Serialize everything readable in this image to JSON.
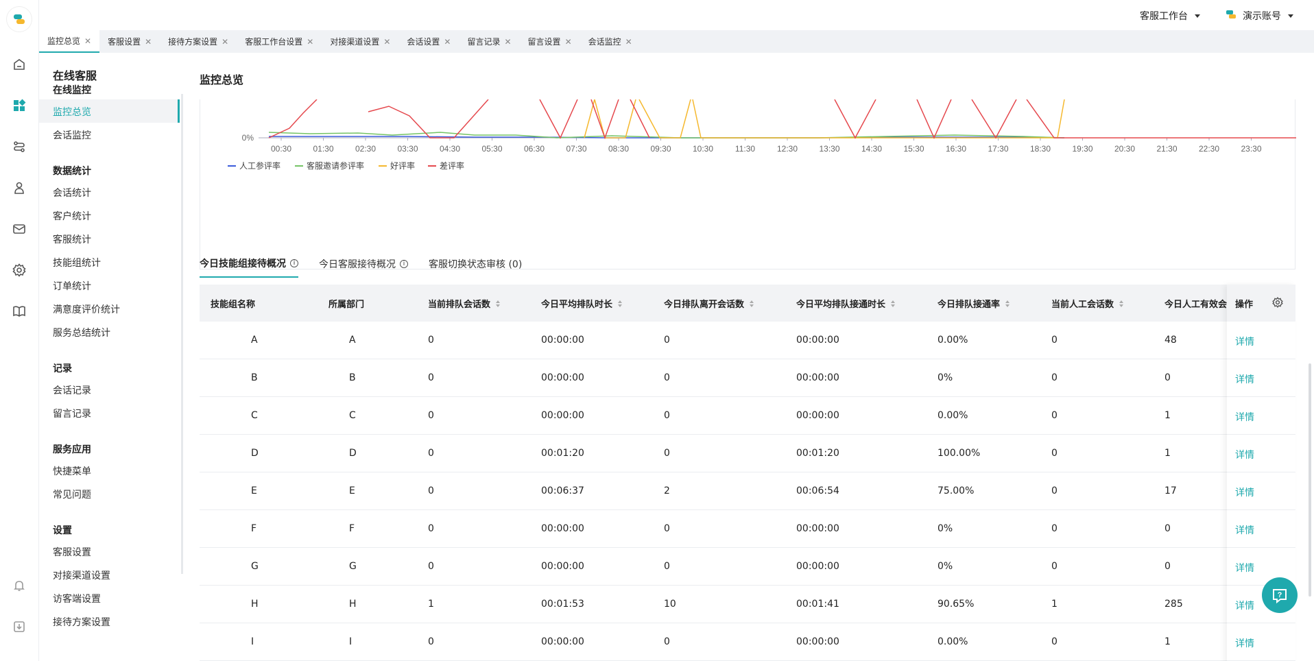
{
  "topbar": {
    "workspace": "客服工作台",
    "account": "演示账号"
  },
  "tabs": [
    "监控总览",
    "客服设置",
    "接待方案设置",
    "客服工作台设置",
    "对接渠道设置",
    "会话设置",
    "留言记录",
    "留言设置",
    "会话监控"
  ],
  "sidebar": {
    "title": "在线客服",
    "groups": [
      {
        "label": "在线监控",
        "items": [
          "监控总览",
          "会话监控"
        ]
      },
      {
        "label": "数据统计",
        "items": [
          "会话统计",
          "客户统计",
          "客服统计",
          "技能组统计",
          "订单统计",
          "满意度评价统计",
          "服务总结统计"
        ]
      },
      {
        "label": "记录",
        "items": [
          "会话记录",
          "留言记录"
        ]
      },
      {
        "label": "服务应用",
        "items": [
          "快捷菜单",
          "常见问题"
        ]
      },
      {
        "label": "设置",
        "items": [
          "客服设置",
          "对接渠道设置",
          "访客端设置",
          "接待方案设置"
        ]
      }
    ]
  },
  "main": {
    "title": "监控总览"
  },
  "chart_data": {
    "type": "line",
    "y_tick_label": "0%",
    "x_ticks": [
      "00:30",
      "01:30",
      "02:30",
      "03:30",
      "04:30",
      "05:30",
      "06:30",
      "07:30",
      "08:30",
      "09:30",
      "10:30",
      "11:30",
      "12:30",
      "13:30",
      "14:30",
      "15:30",
      "16:30",
      "17:30",
      "18:30",
      "19:30",
      "20:30",
      "21:30",
      "22:30",
      "23:30"
    ],
    "legend": [
      "人工参评率",
      "客服邀请参评率",
      "好评率",
      "差评率"
    ],
    "colors": [
      "#3b5bdb",
      "#74c365",
      "#f5b82e",
      "#e5484d"
    ],
    "legend_position": "bottom-left"
  },
  "subtabs": [
    {
      "label": "今日技能组接待概况",
      "active": true
    },
    {
      "label": "今日客服接待概况",
      "active": false
    },
    {
      "label": "客服切换状态审核 (0)",
      "active": false
    }
  ],
  "table": {
    "headers": [
      "技能组名称",
      "所属部门",
      "当前排队会话数",
      "今日平均排队时长",
      "今日排队离开会话数",
      "今日平均排队接通时长",
      "今日排队接通率",
      "当前人工会话数",
      "今日人工有效会",
      "操作"
    ],
    "rows": [
      [
        "A",
        "A",
        "0",
        "00:00:00",
        "0",
        "00:00:00",
        "0.00%",
        "0",
        "48",
        "详情"
      ],
      [
        "B",
        "B",
        "0",
        "00:00:00",
        "0",
        "00:00:00",
        "0%",
        "0",
        "0",
        "详情"
      ],
      [
        "C",
        "C",
        "0",
        "00:00:00",
        "0",
        "00:00:00",
        "0.00%",
        "0",
        "1",
        "详情"
      ],
      [
        "D",
        "D",
        "0",
        "00:01:20",
        "0",
        "00:01:20",
        "100.00%",
        "0",
        "1",
        "详情"
      ],
      [
        "E",
        "E",
        "0",
        "00:06:37",
        "2",
        "00:06:54",
        "75.00%",
        "0",
        "17",
        "详情"
      ],
      [
        "F",
        "F",
        "0",
        "00:00:00",
        "0",
        "00:00:00",
        "0%",
        "0",
        "0",
        "详情"
      ],
      [
        "G",
        "G",
        "0",
        "00:00:00",
        "0",
        "00:00:00",
        "0%",
        "0",
        "0",
        "详情"
      ],
      [
        "H",
        "H",
        "1",
        "00:01:53",
        "10",
        "00:01:41",
        "90.65%",
        "1",
        "285",
        "详情"
      ],
      [
        "I",
        "I",
        "0",
        "00:00:00",
        "0",
        "00:00:00",
        "0.00%",
        "0",
        "1",
        "详情"
      ]
    ]
  }
}
